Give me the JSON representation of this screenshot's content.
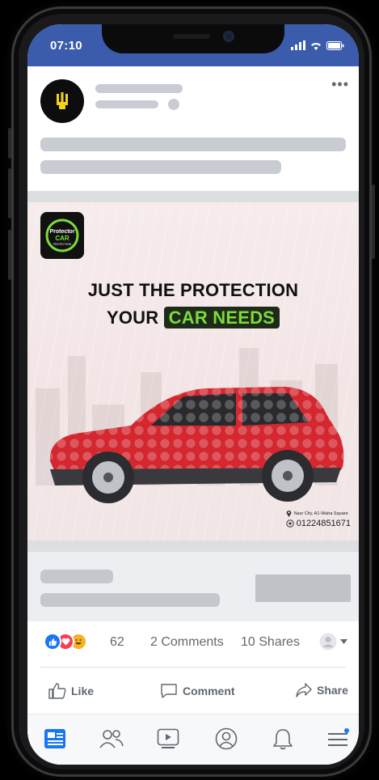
{
  "status_bar": {
    "time": "07:10"
  },
  "ad": {
    "brand_logo_text": "Protector CAR PROTECTION",
    "headline_line1": "JUST THE PROTECTION",
    "headline_line2_prefix": "YOUR ",
    "headline_highlight": "CAR NEEDS",
    "address": "Nasr City, A1-Waha Square",
    "phone": "01224851671"
  },
  "engagement": {
    "reaction_count": "62",
    "comments": "2 Comments",
    "shares": "10 Shares"
  },
  "actions": {
    "like": "Like",
    "comment": "Comment",
    "share": "Share"
  },
  "colors": {
    "facebook_blue": "#3b5cad",
    "highlight_green": "#7bdc3a",
    "car_red": "#d9262e"
  },
  "tabs": [
    "news-feed-icon",
    "friends-icon",
    "watch-icon",
    "profile-icon",
    "notifications-icon",
    "menu-icon"
  ]
}
